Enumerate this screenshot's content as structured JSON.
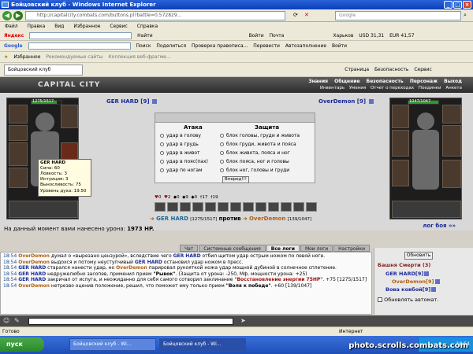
{
  "window": {
    "title": "Бойцовский клуб - Windows Internet Explorer",
    "url": "http://capitalcity.combats.com/buttons.pl?battle=0.572829..."
  },
  "browser": {
    "search_placeholder": "Google",
    "menu": [
      "Файл",
      "Правка",
      "Вид",
      "Избранное",
      "Сервис",
      "Справка"
    ],
    "yandex_toolbar": {
      "brand": "Яндекс",
      "search_button": "Найти",
      "mail": "Почта",
      "weather": "Харьков",
      "usd": "USD 31,31",
      "eur": "EUR 41,57",
      "login": "Войти"
    },
    "google_toolbar": {
      "search": "Поиск",
      "share": "Поделиться",
      "spellcheck": "Проверка правописа...",
      "translate": "Перевести",
      "autofill": "Автозаполнение",
      "signin": "Войти"
    },
    "favorites_bar": {
      "favorites": "Избранное",
      "suggested": "Рекомендуемые сайты",
      "gallery": "Коллекция веб-фрагме..."
    },
    "tab_label": "Бойцовский клуб",
    "command_items": [
      "Страница",
      "Безопасность",
      "Сервис"
    ]
  },
  "game": {
    "logo": "CAPITAL CITY",
    "nav": [
      "Знания",
      "Общение",
      "Безопасность",
      "Персонаж",
      "Выход"
    ],
    "subnav": [
      "Инвентарь",
      "Умения",
      "Отчет о переходах",
      "Поединки",
      "Анкета"
    ],
    "player": {
      "name": "GER HARD",
      "level": "[9]",
      "hp": "1275/1517",
      "hp_frac": 0.84
    },
    "enemy": {
      "name": "OverDemon",
      "level": "[9]",
      "hp": "1047/1047",
      "hp_frac": 1.0
    },
    "tooltip": {
      "name": "GER HARD",
      "lines": [
        "Сила: 60",
        "Ловкость: 3",
        "Интуиция: 3",
        "Выносливость: 75",
        "",
        "Уровень духа: 19.50"
      ]
    },
    "attack": {
      "title": "Атака",
      "options": [
        "удар в голову",
        "удар в грудь",
        "удар в живот",
        "удар в пояс(пах)",
        "удар по ногам"
      ]
    },
    "defense": {
      "title": "Защита",
      "options": [
        "блок головы, груди и живота",
        "блок груди, живота и пояса",
        "блок живота, пояса и ног",
        "блок пояса, ног и головы",
        "блок ног, головы и груди"
      ]
    },
    "go_button": "Вперед!!!",
    "counters": [
      "0",
      "2",
      "0",
      "9",
      "0",
      "17",
      "19"
    ],
    "versus": {
      "me": "GER HARD",
      "me_hp": "[1275/1517]",
      "word": "против",
      "enemy": "OverDemon",
      "enemy_hp": "[139/1047]"
    },
    "damage_text": "На данный момент вами нанесено урона:",
    "damage_value": "1973 HP.",
    "log_link": "лог боя »»",
    "log_tabs": [
      "Чат",
      "Системные сообщения",
      "Все логи",
      "Мои логи",
      "Настройки"
    ],
    "chat_lines": [
      {
        "t": "18:54",
        "a": "OverDemon",
        "a_color": "orange",
        "text": "думал о «вырезано цензурой», вследствие чего",
        "b": "GER HARD",
        "c": "отбил щитом удар острым ножом по левой ноге."
      },
      {
        "t": "18:54",
        "a": "OverDemon",
        "a_color": "orange",
        "text": "выдохся и потому неуступчивый",
        "b": "GER HARD",
        "c": "остановил удар ножом в пресс."
      },
      {
        "t": "18:54",
        "a": "GER HARD",
        "a_color": "blue",
        "text": "старался нанести удар, но",
        "b": "OverDemon",
        "c": "парировал рукояткой ножа удар мощной дубиной в солнечное сплетение."
      },
      {
        "t": "18:54",
        "a": "GER HARD",
        "a_color": "blue",
        "text": "недружелюбно засопев, применил прием",
        "b": "\"Рывок\"",
        "c": ". (Защита от урона: -250, Мф. мощности урона: +25)"
      },
      {
        "t": "18:54",
        "a": "GER HARD",
        "a_color": "blue",
        "text": "закричал от испуга, и неожиданно для себя самого сотворил заклинание",
        "b": "\"Восстановление энергии 75HP\"",
        "c": ". +75 [1275/1517]"
      },
      {
        "t": "18:54",
        "a": "OverDemon",
        "a_color": "orange",
        "text": "нетрезво оценив положение, решил, что поможет ему только прием",
        "b": "\"Воля к победе\"",
        "c": ". +60 [139/1047]"
      }
    ],
    "side": {
      "refresh": "Обновить",
      "location": "Башня Смерти",
      "location_count": "(3)",
      "players": [
        "GER HARD[9]",
        "OverDemon[9]",
        "Вова ковбой[9]"
      ],
      "auto_refresh": "Обновлять автомат."
    }
  },
  "status": {
    "text": "Готово",
    "zone": "Интернет"
  },
  "taskbar": {
    "start": "пуск",
    "tasks": [
      "Бойцовский клуб - Wi...",
      "Бойцовский клуб - Wi..."
    ],
    "clock": "18:54"
  },
  "watermark": "photo.scrolls.combats.com"
}
